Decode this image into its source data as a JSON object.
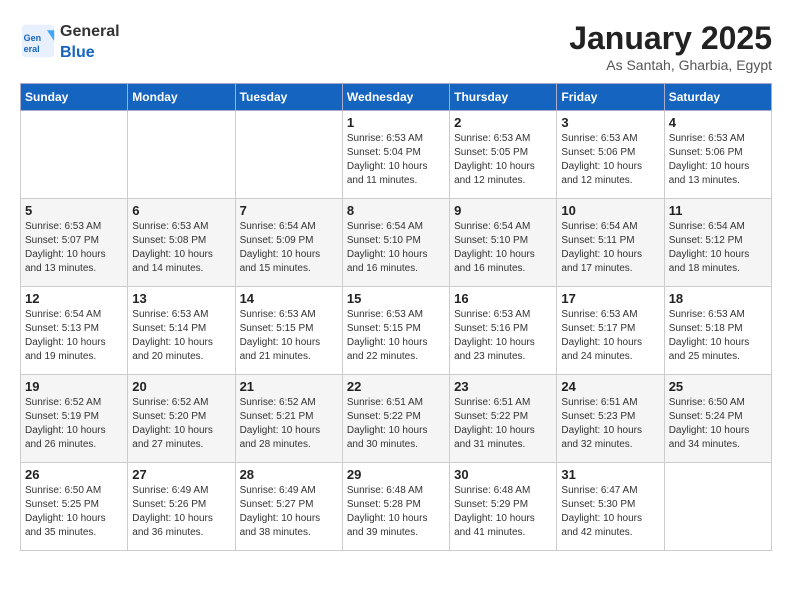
{
  "logo": {
    "general": "General",
    "blue": "Blue"
  },
  "title": "January 2025",
  "location": "As Santah, Gharbia, Egypt",
  "weekdays": [
    "Sunday",
    "Monday",
    "Tuesday",
    "Wednesday",
    "Thursday",
    "Friday",
    "Saturday"
  ],
  "weeks": [
    [
      {
        "day": "",
        "info": ""
      },
      {
        "day": "",
        "info": ""
      },
      {
        "day": "",
        "info": ""
      },
      {
        "day": "1",
        "info": "Sunrise: 6:53 AM\nSunset: 5:04 PM\nDaylight: 10 hours\nand 11 minutes."
      },
      {
        "day": "2",
        "info": "Sunrise: 6:53 AM\nSunset: 5:05 PM\nDaylight: 10 hours\nand 12 minutes."
      },
      {
        "day": "3",
        "info": "Sunrise: 6:53 AM\nSunset: 5:06 PM\nDaylight: 10 hours\nand 12 minutes."
      },
      {
        "day": "4",
        "info": "Sunrise: 6:53 AM\nSunset: 5:06 PM\nDaylight: 10 hours\nand 13 minutes."
      }
    ],
    [
      {
        "day": "5",
        "info": "Sunrise: 6:53 AM\nSunset: 5:07 PM\nDaylight: 10 hours\nand 13 minutes."
      },
      {
        "day": "6",
        "info": "Sunrise: 6:53 AM\nSunset: 5:08 PM\nDaylight: 10 hours\nand 14 minutes."
      },
      {
        "day": "7",
        "info": "Sunrise: 6:54 AM\nSunset: 5:09 PM\nDaylight: 10 hours\nand 15 minutes."
      },
      {
        "day": "8",
        "info": "Sunrise: 6:54 AM\nSunset: 5:10 PM\nDaylight: 10 hours\nand 16 minutes."
      },
      {
        "day": "9",
        "info": "Sunrise: 6:54 AM\nSunset: 5:10 PM\nDaylight: 10 hours\nand 16 minutes."
      },
      {
        "day": "10",
        "info": "Sunrise: 6:54 AM\nSunset: 5:11 PM\nDaylight: 10 hours\nand 17 minutes."
      },
      {
        "day": "11",
        "info": "Sunrise: 6:54 AM\nSunset: 5:12 PM\nDaylight: 10 hours\nand 18 minutes."
      }
    ],
    [
      {
        "day": "12",
        "info": "Sunrise: 6:54 AM\nSunset: 5:13 PM\nDaylight: 10 hours\nand 19 minutes."
      },
      {
        "day": "13",
        "info": "Sunrise: 6:53 AM\nSunset: 5:14 PM\nDaylight: 10 hours\nand 20 minutes."
      },
      {
        "day": "14",
        "info": "Sunrise: 6:53 AM\nSunset: 5:15 PM\nDaylight: 10 hours\nand 21 minutes."
      },
      {
        "day": "15",
        "info": "Sunrise: 6:53 AM\nSunset: 5:15 PM\nDaylight: 10 hours\nand 22 minutes."
      },
      {
        "day": "16",
        "info": "Sunrise: 6:53 AM\nSunset: 5:16 PM\nDaylight: 10 hours\nand 23 minutes."
      },
      {
        "day": "17",
        "info": "Sunrise: 6:53 AM\nSunset: 5:17 PM\nDaylight: 10 hours\nand 24 minutes."
      },
      {
        "day": "18",
        "info": "Sunrise: 6:53 AM\nSunset: 5:18 PM\nDaylight: 10 hours\nand 25 minutes."
      }
    ],
    [
      {
        "day": "19",
        "info": "Sunrise: 6:52 AM\nSunset: 5:19 PM\nDaylight: 10 hours\nand 26 minutes."
      },
      {
        "day": "20",
        "info": "Sunrise: 6:52 AM\nSunset: 5:20 PM\nDaylight: 10 hours\nand 27 minutes."
      },
      {
        "day": "21",
        "info": "Sunrise: 6:52 AM\nSunset: 5:21 PM\nDaylight: 10 hours\nand 28 minutes."
      },
      {
        "day": "22",
        "info": "Sunrise: 6:51 AM\nSunset: 5:22 PM\nDaylight: 10 hours\nand 30 minutes."
      },
      {
        "day": "23",
        "info": "Sunrise: 6:51 AM\nSunset: 5:22 PM\nDaylight: 10 hours\nand 31 minutes."
      },
      {
        "day": "24",
        "info": "Sunrise: 6:51 AM\nSunset: 5:23 PM\nDaylight: 10 hours\nand 32 minutes."
      },
      {
        "day": "25",
        "info": "Sunrise: 6:50 AM\nSunset: 5:24 PM\nDaylight: 10 hours\nand 34 minutes."
      }
    ],
    [
      {
        "day": "26",
        "info": "Sunrise: 6:50 AM\nSunset: 5:25 PM\nDaylight: 10 hours\nand 35 minutes."
      },
      {
        "day": "27",
        "info": "Sunrise: 6:49 AM\nSunset: 5:26 PM\nDaylight: 10 hours\nand 36 minutes."
      },
      {
        "day": "28",
        "info": "Sunrise: 6:49 AM\nSunset: 5:27 PM\nDaylight: 10 hours\nand 38 minutes."
      },
      {
        "day": "29",
        "info": "Sunrise: 6:48 AM\nSunset: 5:28 PM\nDaylight: 10 hours\nand 39 minutes."
      },
      {
        "day": "30",
        "info": "Sunrise: 6:48 AM\nSunset: 5:29 PM\nDaylight: 10 hours\nand 41 minutes."
      },
      {
        "day": "31",
        "info": "Sunrise: 6:47 AM\nSunset: 5:30 PM\nDaylight: 10 hours\nand 42 minutes."
      },
      {
        "day": "",
        "info": ""
      }
    ]
  ]
}
